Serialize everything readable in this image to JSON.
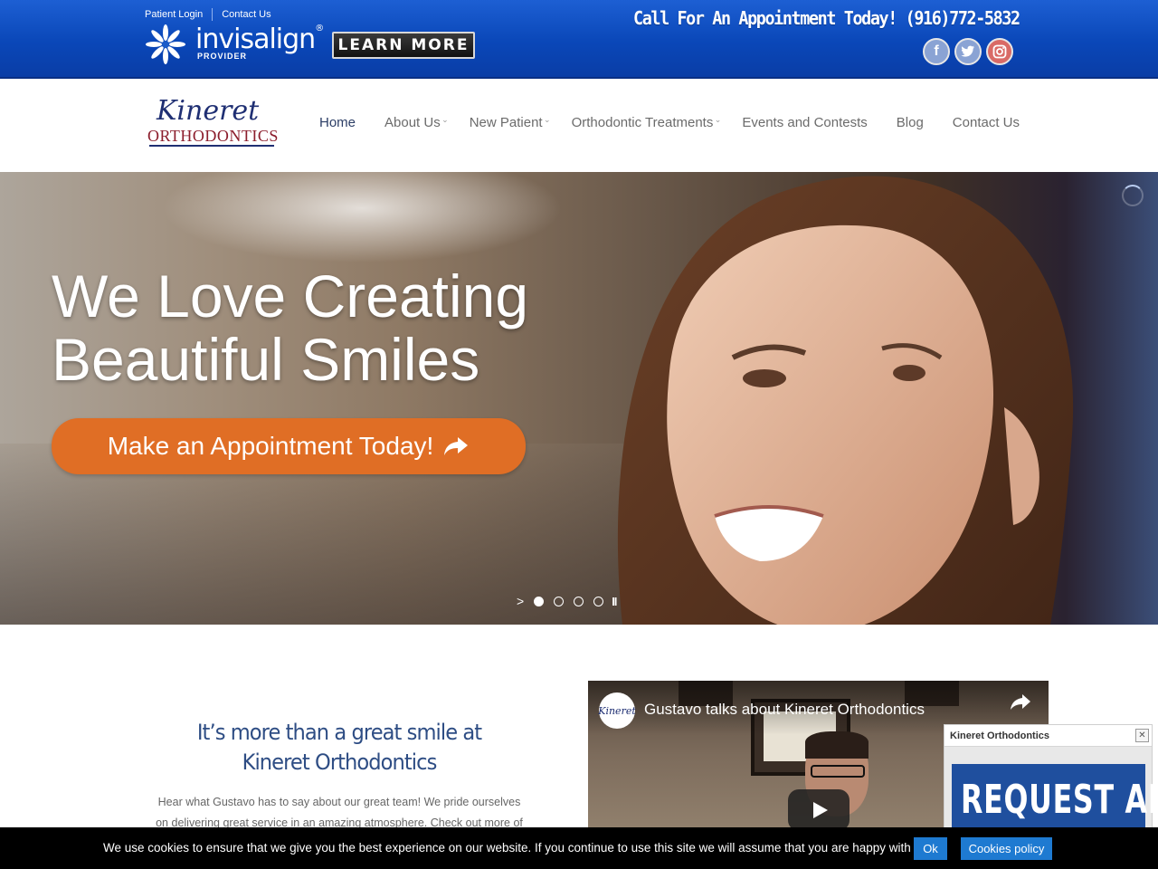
{
  "topbar": {
    "patient_login": "Patient Login",
    "contact_us": "Contact Us",
    "invisalign_brand": "invisalign",
    "invisalign_reg": "®",
    "invisalign_sub": "PROVIDER",
    "learn_more": "LEARN MORE",
    "call_text": "Call For An Appointment Today! (916)772-5832",
    "social": [
      {
        "name": "facebook-icon",
        "glyph": "f"
      },
      {
        "name": "twitter-icon",
        "glyph": "t"
      },
      {
        "name": "instagram-icon",
        "glyph": "◎"
      }
    ]
  },
  "logo": {
    "script": "Kineret",
    "sub": "ORTHODONTICS"
  },
  "nav": {
    "items": [
      {
        "label": "Home",
        "active": true,
        "dropdown": false
      },
      {
        "label": "About Us",
        "active": false,
        "dropdown": true
      },
      {
        "label": "New Patient",
        "active": false,
        "dropdown": true
      },
      {
        "label": "Orthodontic Treatments",
        "active": false,
        "dropdown": true
      },
      {
        "label": "Events and Contests",
        "active": false,
        "dropdown": false
      },
      {
        "label": "Blog",
        "active": false,
        "dropdown": false
      },
      {
        "label": "Contact Us",
        "active": false,
        "dropdown": false
      }
    ]
  },
  "hero": {
    "title_line1": "We Love Creating",
    "title_line2": "Beautiful Smiles",
    "cta": "Make an Appointment Today!",
    "cta_icon": "share-arrow-icon",
    "slides_total": 4,
    "slide_active": 1,
    "next_glyph": ">",
    "pause_glyph": "II"
  },
  "intro": {
    "title": "It’s more than a great smile at Kineret Orthodontics",
    "text": "Hear what Gustavo has to say about our great team! We pride ourselves on delivering great service in an amazing atmosphere. Check out more of"
  },
  "video": {
    "title": "Gustavo talks about Kineret Orthodontics",
    "channel_avatar": "Kineret"
  },
  "widget": {
    "title": "Kineret Orthodontics",
    "close": "✕",
    "banner": "REQUEST AN"
  },
  "cookie": {
    "text": "We use cookies to ensure that we give you the best experience on our website. If you continue to use this site we will assume that you are happy with it.",
    "ok": "Ok",
    "policy": "Cookies policy"
  },
  "colors": {
    "topbar": "#0a47b8",
    "cta": "#e06e25",
    "nav_text": "#6b6b6b",
    "title_blue": "#2e4d84",
    "cookie_button": "#1e7ad1"
  }
}
